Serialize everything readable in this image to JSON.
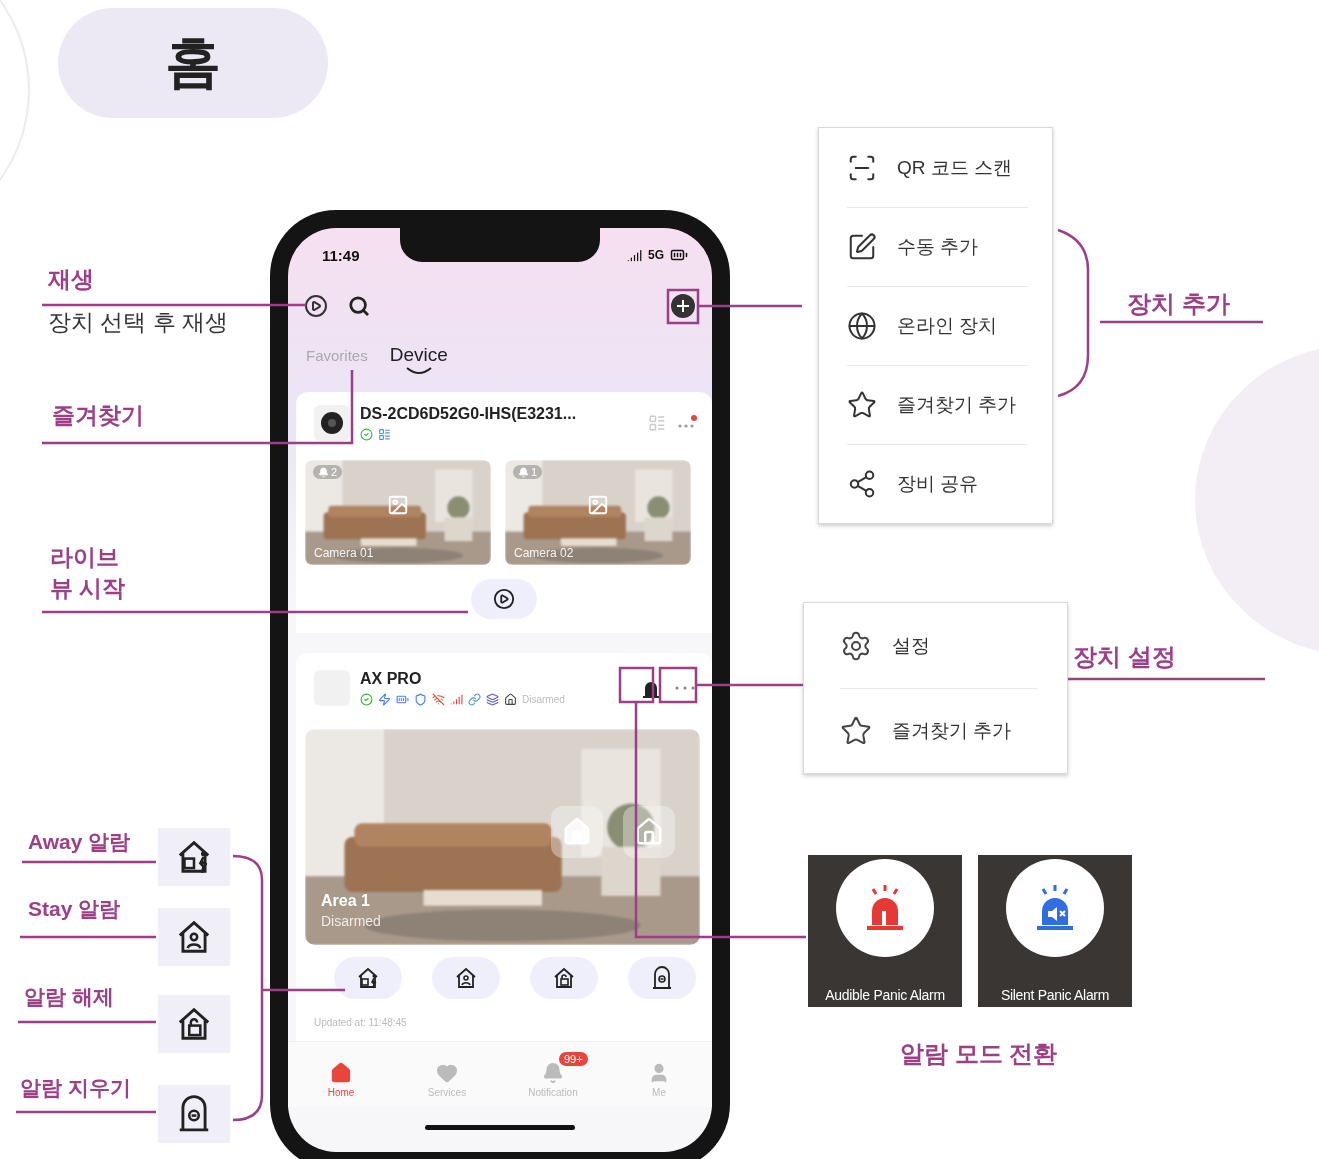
{
  "page_title": "홈",
  "phone": {
    "status_bar": {
      "time": "11:49",
      "network": "5G"
    },
    "tabs": [
      {
        "label": "Favorites",
        "selected": false
      },
      {
        "label": "Device",
        "selected": true
      }
    ],
    "devices": [
      {
        "kind": "camera",
        "name": "DS-2CD6D52G0-IHS(E3231...",
        "cameras": [
          {
            "name": "Camera 01",
            "alerts": "2"
          },
          {
            "name": "Camera 02",
            "alerts": "1"
          }
        ]
      },
      {
        "kind": "alarm",
        "name": "AX PRO",
        "status": "Disarmed",
        "area": {
          "name": "Area 1",
          "status": "Disarmed"
        }
      }
    ],
    "updated": "Updated at: 11:48:45",
    "nav": [
      {
        "label": "Home",
        "selected": true
      },
      {
        "label": "Services",
        "selected": false
      },
      {
        "label": "Notification",
        "selected": false,
        "badge": "99+"
      },
      {
        "label": "Me",
        "selected": false
      }
    ]
  },
  "left_notes": [
    {
      "title": "재생",
      "detail": "장치 선택 후 재생"
    },
    {
      "title": "즐겨찾기"
    },
    {
      "title": "라이브 뷰 시작"
    }
  ],
  "alarm_notes": [
    "Away 알람",
    "Stay 알람",
    "알람 해제",
    "알람 지우기"
  ],
  "add_menu": {
    "label": "장치 추가",
    "items": [
      "QR 코드 스캔",
      "수동 추가",
      "온라인 장치",
      "즐겨찾기 추가",
      "장비 공유"
    ]
  },
  "settings_menu": {
    "label": "장치 설정",
    "items": [
      "설정",
      "즐겨찾기 추가"
    ]
  },
  "panic_modes": {
    "label": "알람 모드 전환",
    "modes": [
      {
        "kind": "audible",
        "label": "Audible Panic Alarm"
      },
      {
        "kind": "silent",
        "label": "Silent Panic Alarm"
      }
    ]
  }
}
